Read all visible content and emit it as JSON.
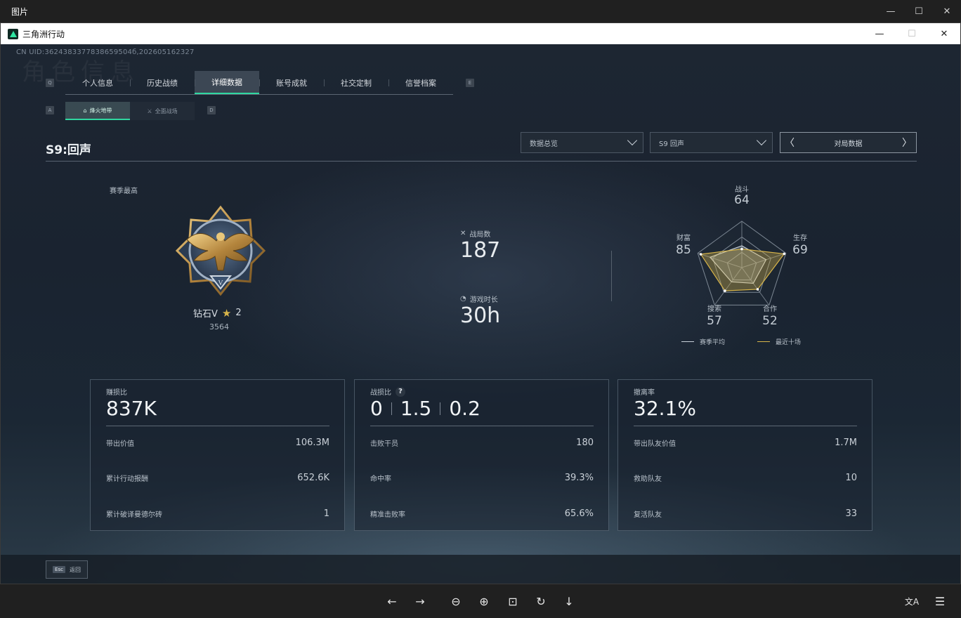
{
  "viewer": {
    "title": "图片",
    "controls": {
      "minimize": "—",
      "maximize": "☐",
      "close": "✕"
    },
    "toolbar": {
      "back": "←",
      "forward": "→",
      "zoom_out": "⊖",
      "zoom_in": "⊕",
      "fit": "⊡",
      "rotate": "↻",
      "download": "↓",
      "translate": "文A",
      "ocr": "☰"
    }
  },
  "app": {
    "title": "三角洲行动",
    "controls": {
      "minimize": "—",
      "maximize": "☐",
      "close": "✕"
    }
  },
  "game": {
    "uid": "CN UID:3624383377838659504б,202605162327",
    "ghost_text": "角色信息",
    "key_left": "Q",
    "key_right": "E",
    "sub_key_left": "A",
    "sub_key_right": "D",
    "tabs": [
      "个人信息",
      "历史战绩",
      "详细数据",
      "账号成就",
      "社交定制",
      "信誉档案"
    ],
    "active_tab": 2,
    "subtabs": [
      {
        "label": "烽火地带",
        "icon": "⌂"
      },
      {
        "label": "全面战场",
        "icon": "⚔"
      }
    ],
    "season_title": "S9:回声",
    "dropdown_overview": "数据总览",
    "dropdown_season": "S9 回声",
    "pager_label": "对局数据",
    "pager_prev": "〈",
    "pager_next": "〉",
    "best_label": "赛季最高",
    "rank": {
      "name": "钻石V",
      "stars": "2",
      "star_icon": "★",
      "score": "3564"
    },
    "matches": {
      "label": "战局数",
      "value": "187",
      "icon": "✕"
    },
    "playtime": {
      "label": "游戏时长",
      "value": "30h",
      "icon": "◔"
    },
    "radar": {
      "axes": [
        {
          "label": "战斗",
          "value": "64"
        },
        {
          "label": "生存",
          "value": "69"
        },
        {
          "label": "合作",
          "value": "52"
        },
        {
          "label": "搜索",
          "value": "57"
        },
        {
          "label": "财富",
          "value": "85"
        }
      ],
      "season_avg": [
        0.47,
        0.55,
        0.42,
        0.38,
        0.72
      ],
      "recent_ten": [
        0.4,
        0.96,
        0.58,
        0.62,
        0.93
      ],
      "legend_avg": "赛季平均",
      "legend_recent": "最近十场",
      "color_avg": "#c9d2da",
      "color_recent": "#d8b54a"
    },
    "cards": [
      {
        "title": "赚损比",
        "big": [
          "837K"
        ],
        "rows": [
          {
            "k": "带出价值",
            "v": "106.3M"
          },
          {
            "k": "累计行动报酬",
            "v": "652.6K"
          },
          {
            "k": "累计破译曼德尔砖",
            "v": "1"
          }
        ]
      },
      {
        "title": "战损比",
        "help": "?",
        "big": [
          "0",
          "1.5",
          "0.2"
        ],
        "rows": [
          {
            "k": "击败干员",
            "v": "180"
          },
          {
            "k": "命中率",
            "v": "39.3%"
          },
          {
            "k": "精准击败率",
            "v": "65.6%"
          }
        ]
      },
      {
        "title": "撤离率",
        "big": [
          "32.1%"
        ],
        "rows": [
          {
            "k": "带出队友价值",
            "v": "1.7M"
          },
          {
            "k": "救助队友",
            "v": "10"
          },
          {
            "k": "复活队友",
            "v": "33"
          }
        ]
      }
    ],
    "esc_key": "Esc",
    "esc_label": "返回",
    "accent": "#2fd7a0"
  }
}
